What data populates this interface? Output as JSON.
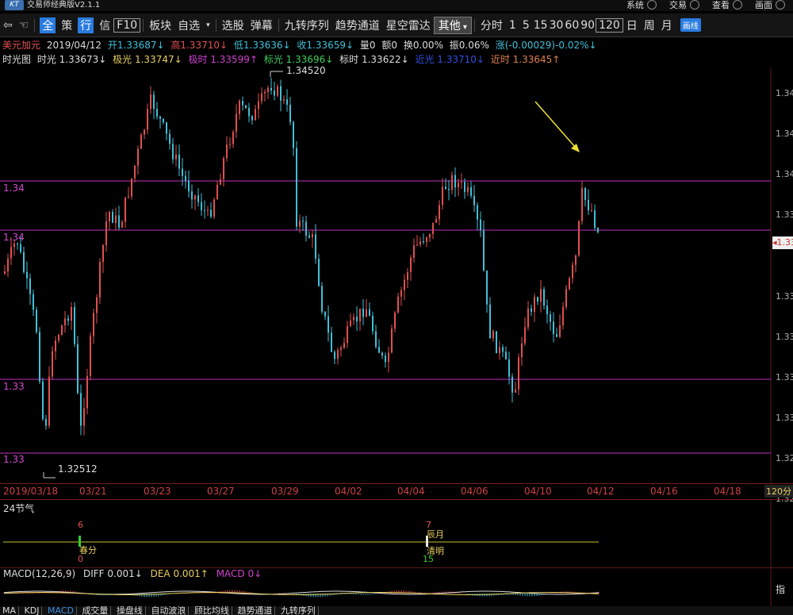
{
  "title": {
    "app": "交易师经典版V2.1.1",
    "menus": [
      "系统",
      "交易",
      "查看",
      "画面"
    ]
  },
  "toolbar": {
    "items": [
      "全",
      "策",
      "行",
      "信",
      "F10",
      "板块",
      "自选",
      "选股",
      "弹幕",
      "九转序列",
      "趋势通道",
      "星空雷达",
      "其他",
      "分时",
      "1",
      "5",
      "15",
      "30",
      "60",
      "90",
      "120",
      "日",
      "周",
      "月",
      "画线"
    ]
  },
  "info1": {
    "name": "美元加元",
    "date": "2019/04/12",
    "open": "开1.33687↓",
    "high": "高1.33710↓",
    "low": "低1.33636↓",
    "close": "收1.33659↓",
    "vol": "量0",
    "amt": "额0",
    "turn": "换0.00%",
    "amp": "振0.06%",
    "chg": "涨(-0.00029)-0.02%↓"
  },
  "info2": {
    "name": "时光图",
    "a": "时光 1.33673↓",
    "b": "极光 1.33747↓",
    "c": "极时 1.33599↑",
    "d": "标光 1.33696↓",
    "e": "标时 1.33622↓",
    "f": "近光 1.33710↓",
    "g": "近时 1.33645↑"
  },
  "levels": [
    "1.34",
    "1.34",
    "1.33",
    "1.33"
  ],
  "right_axis": [
    "1.34",
    "1.34",
    "1.34",
    "1.33",
    "1.33",
    "1.33",
    "1.33",
    "1.33",
    "1.32",
    "1.32"
  ],
  "current_price": "1.33",
  "extremes": {
    "high": "1.34520",
    "low": "1.32512"
  },
  "dates": [
    "2019/03/18",
    "03/21",
    "03/23",
    "03/27",
    "03/29",
    "04/02",
    "04/04",
    "04/06",
    "04/10",
    "04/12",
    "04/16",
    "04/18"
  ],
  "period_badge": "120分",
  "solar": {
    "title": "24节气",
    "e1_top": "6",
    "e1_label": "春分",
    "e1_bottom": "0",
    "e2_top": "7",
    "e2_label1": "辰月",
    "e2_label2": "清明",
    "e2_bottom": "15"
  },
  "macd": {
    "name": "MACD(12,26,9)",
    "diff": "DIFF 0.001↓",
    "dea": "DEA 0.001↑",
    "macd": "MACD 0↓",
    "right": "指"
  },
  "tabs": [
    "MA",
    "KDJ",
    "MACD",
    "成交量",
    "操盘线",
    "自动波浪",
    "顾比均线",
    "趋势通道",
    "九转序列"
  ],
  "colors": {
    "up": "#e05050",
    "down": "#40c0d8",
    "level": "#c030c0",
    "arrow": "#f0e030"
  }
}
